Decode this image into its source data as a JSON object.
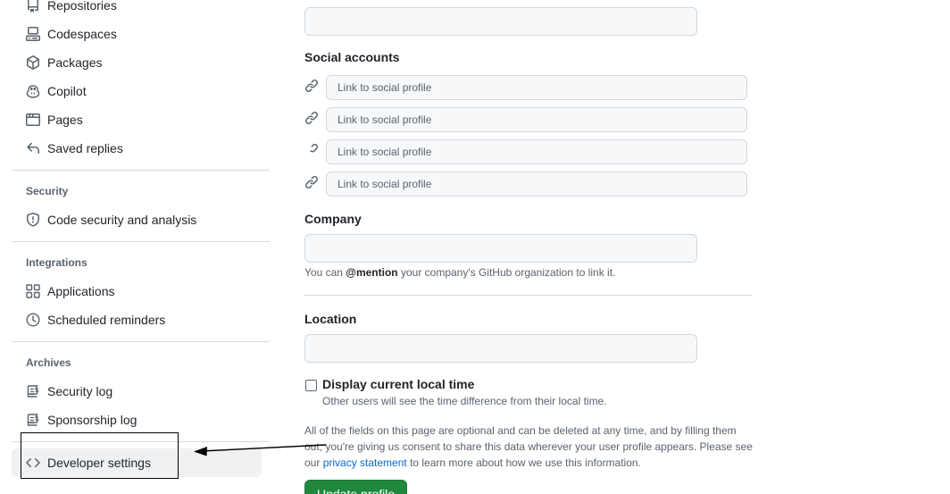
{
  "sidebar": {
    "items_top": [
      {
        "label": "Repositories",
        "icon": "repo-icon"
      },
      {
        "label": "Codespaces",
        "icon": "codespaces-icon"
      },
      {
        "label": "Packages",
        "icon": "package-icon"
      },
      {
        "label": "Copilot",
        "icon": "copilot-icon"
      },
      {
        "label": "Pages",
        "icon": "browser-icon"
      },
      {
        "label": "Saved replies",
        "icon": "reply-icon"
      }
    ],
    "security": {
      "heading": "Security",
      "items": [
        {
          "label": "Code security and analysis",
          "icon": "shield-icon"
        }
      ]
    },
    "integrations": {
      "heading": "Integrations",
      "items": [
        {
          "label": "Applications",
          "icon": "apps-icon"
        },
        {
          "label": "Scheduled reminders",
          "icon": "clock-icon"
        }
      ]
    },
    "archives": {
      "heading": "Archives",
      "items": [
        {
          "label": "Security log",
          "icon": "log-icon"
        },
        {
          "label": "Sponsorship log",
          "icon": "log-icon"
        }
      ]
    },
    "developer": {
      "label": "Developer settings",
      "icon": "code-icon"
    }
  },
  "main": {
    "social": {
      "heading": "Social accounts",
      "placeholder": "Link to social profile",
      "links": [
        "",
        "",
        "",
        ""
      ]
    },
    "company": {
      "label": "Company",
      "value": "",
      "hint_prefix": "You can ",
      "hint_mention": "@mention",
      "hint_suffix": " your company's GitHub organization to link it."
    },
    "location": {
      "label": "Location",
      "value": ""
    },
    "local_time": {
      "label": "Display current local time",
      "description": "Other users will see the time difference from their local time.",
      "checked": false
    },
    "notice": {
      "text_before": "All of the fields on this page are optional and can be deleted at any time, and by filling them out, you're giving us consent to share this data wherever your user profile appears. Please see our ",
      "link": "privacy statement",
      "text_after": " to learn more about how we use this information."
    },
    "submit_label": "Update profile"
  },
  "colors": {
    "accent_green": "#1f883d",
    "link_blue": "#0969da",
    "muted_text": "#59636e",
    "border": "#d1d9e0"
  }
}
